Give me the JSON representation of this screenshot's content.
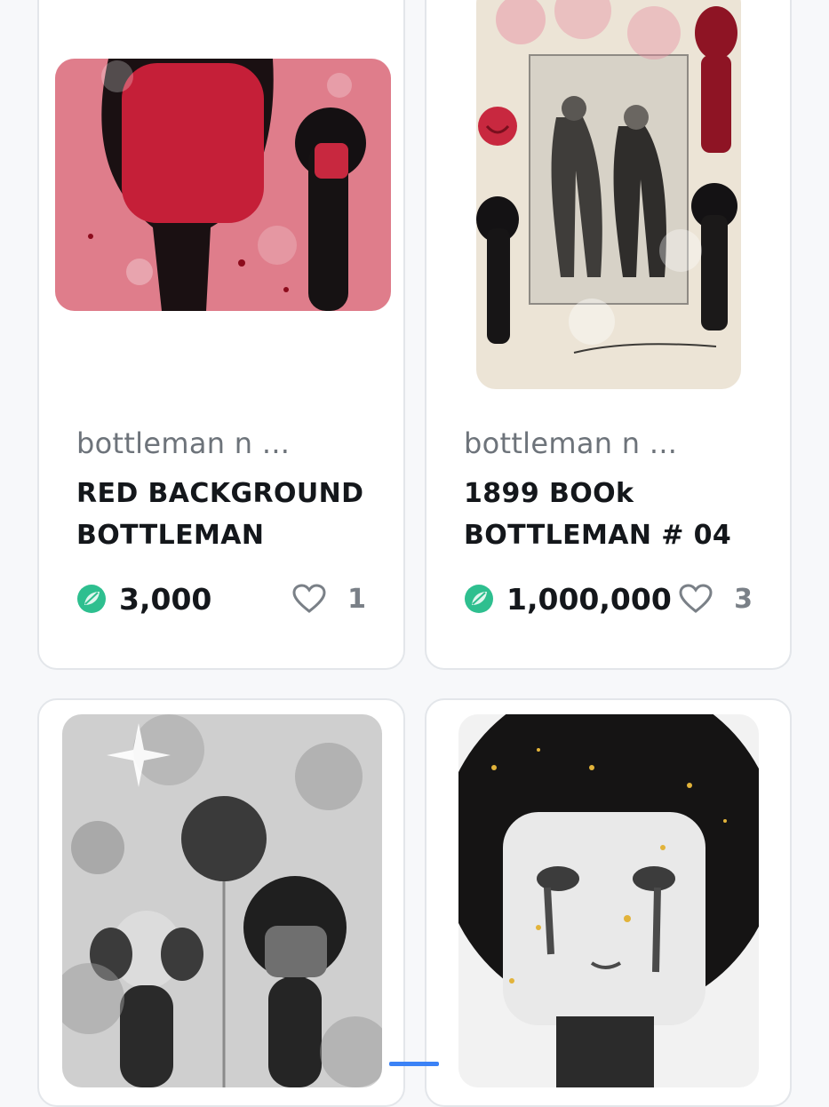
{
  "cards": [
    {
      "creator": "bottleman n ...",
      "title": "RED BACKGROUND BOTTLEMAN",
      "price": "3,000",
      "likes": "1"
    },
    {
      "creator": "bottleman n ...",
      "title": "1899 BOOk BOTTLEMAN # 04",
      "price": "1,000,000",
      "likes": "3"
    }
  ],
  "icons": {
    "token": "token-leaf-icon",
    "like": "heart-outline-icon"
  },
  "colors": {
    "token_green": "#2ebf8f",
    "text_dark": "#14171b",
    "text_muted": "#6d737a"
  }
}
